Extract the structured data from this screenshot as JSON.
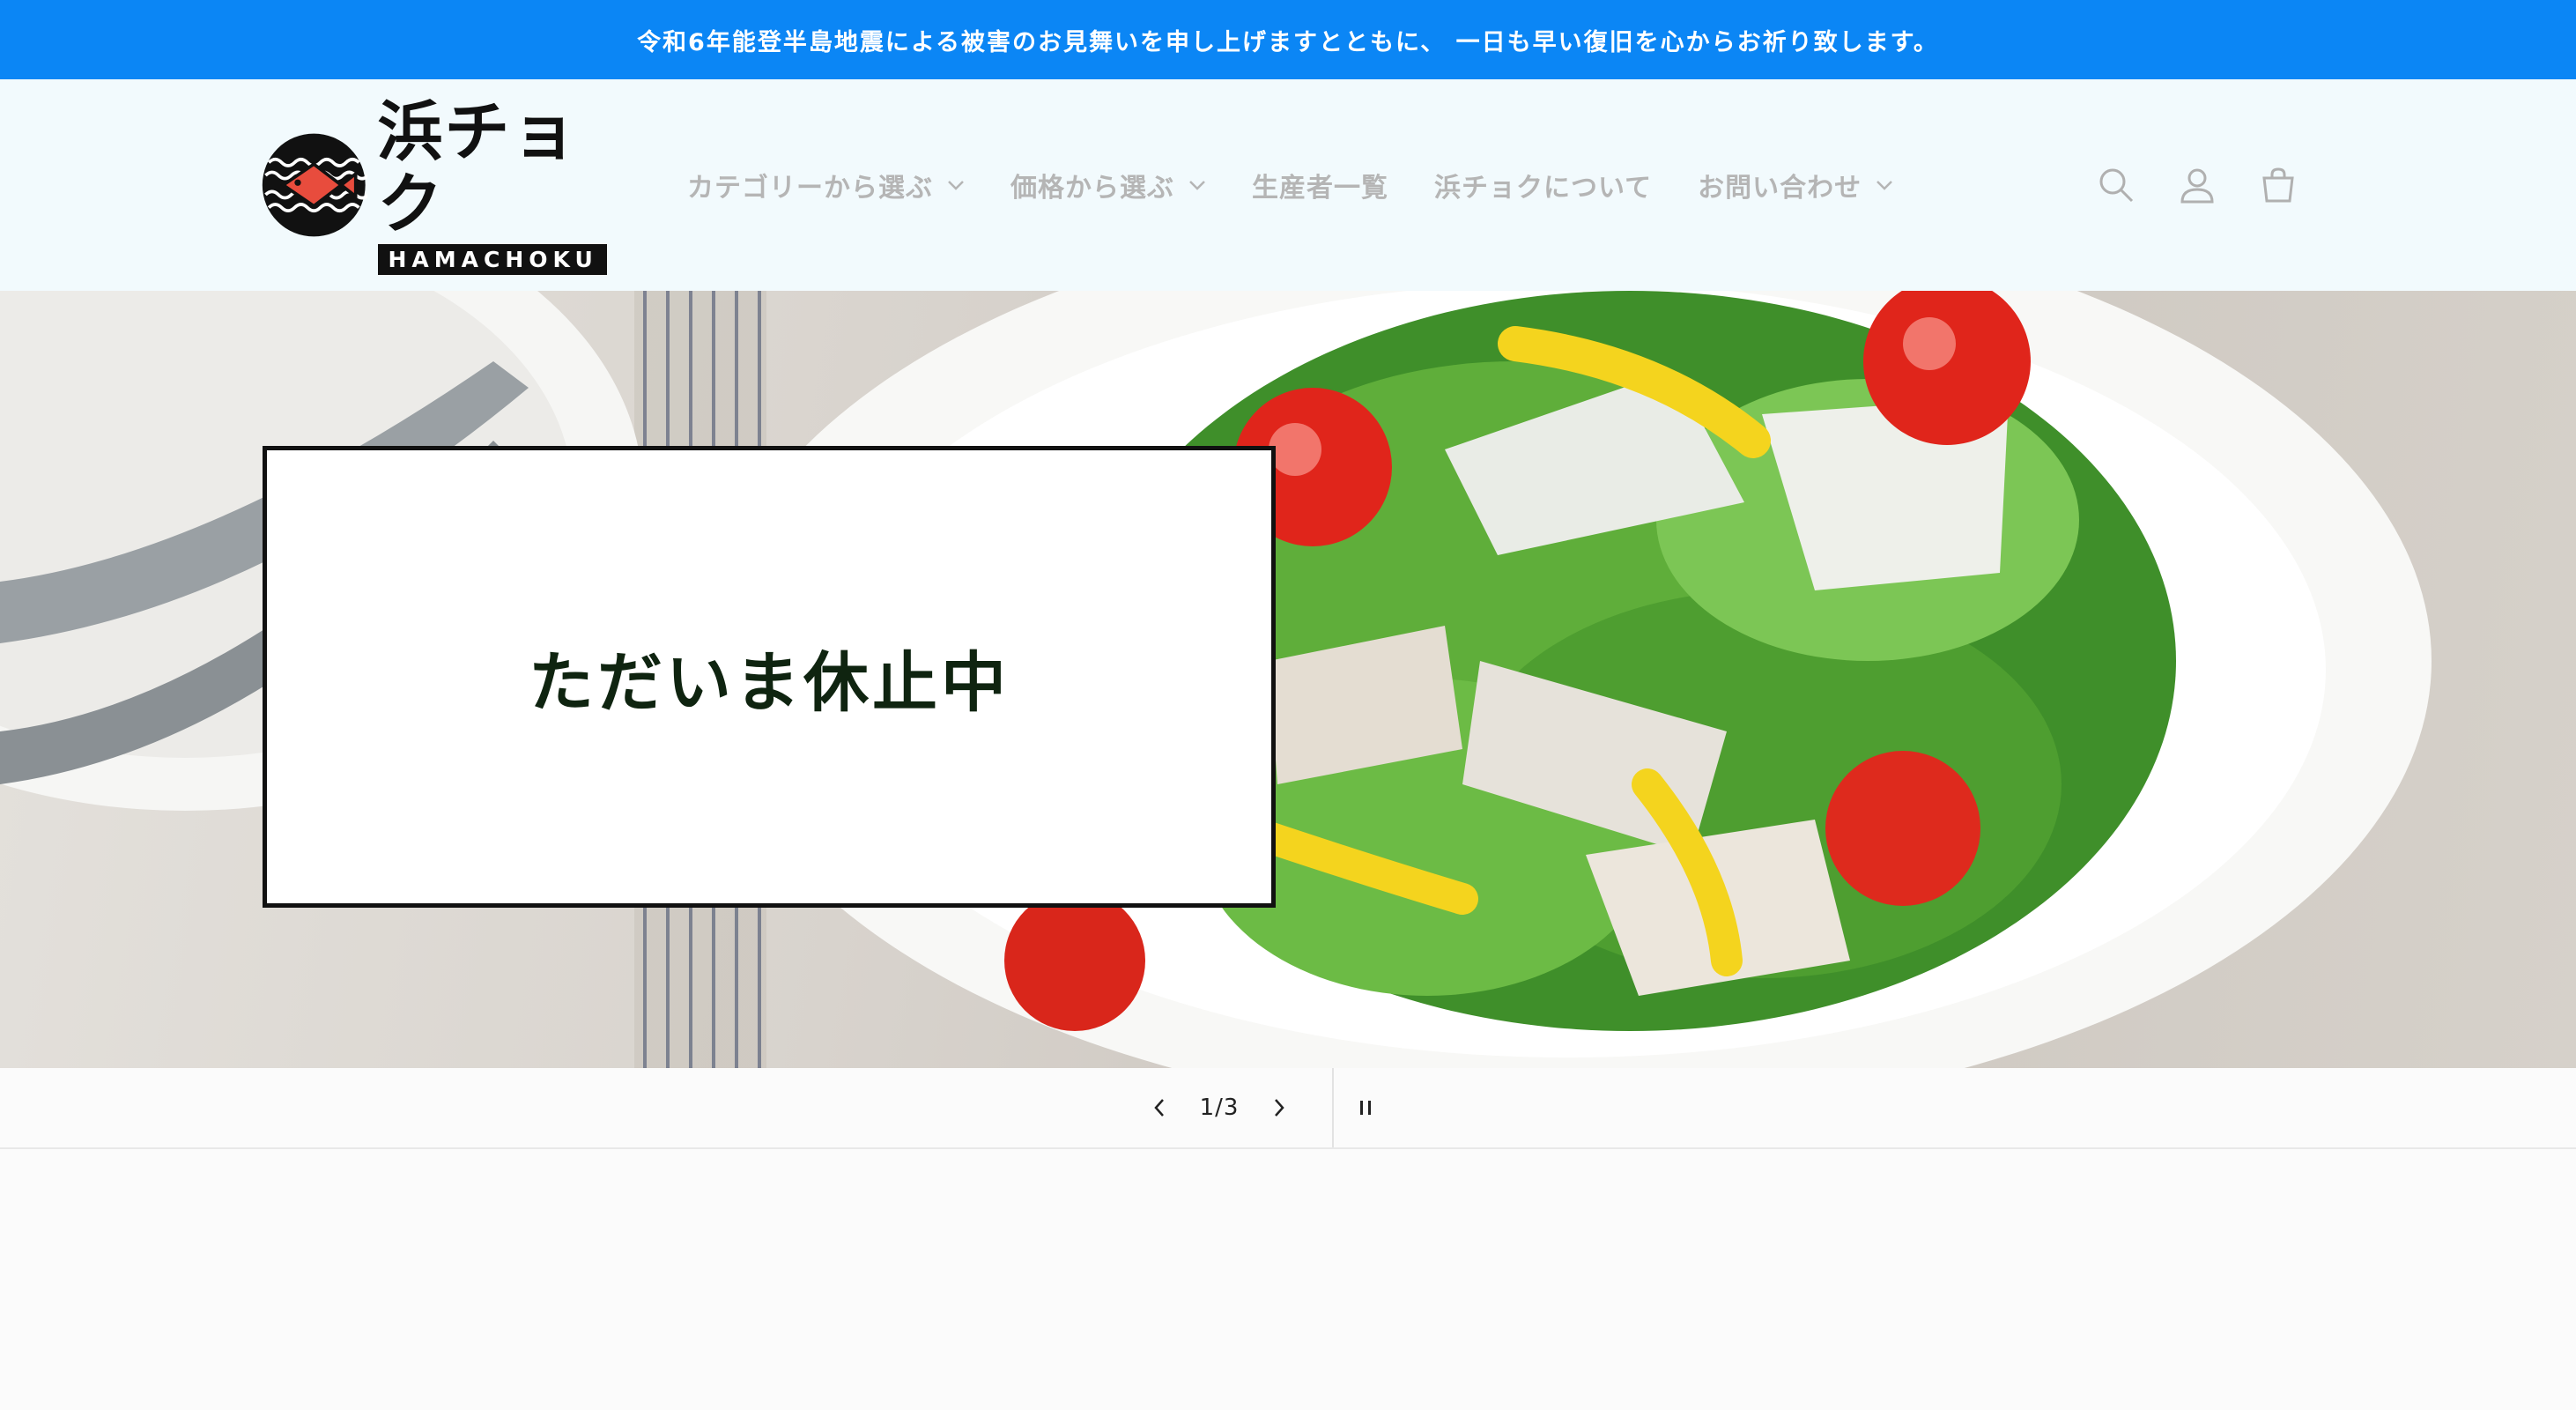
{
  "announcement": {
    "text": "令和6年能登半島地震による被害のお見舞いを申し上げますとともに、 一日も早い復旧を心からお祈り致します。"
  },
  "brand": {
    "name_jp": "浜チョク",
    "name_en": "HAMACHOKU",
    "accent_color": "#e84c3d"
  },
  "nav": {
    "items": [
      {
        "label": "カテゴリーから選ぶ",
        "has_dropdown": true
      },
      {
        "label": "価格から選ぶ",
        "has_dropdown": true
      },
      {
        "label": "生産者一覧",
        "has_dropdown": false
      },
      {
        "label": "浜チョクについて",
        "has_dropdown": false
      },
      {
        "label": "お問い合わせ",
        "has_dropdown": true
      }
    ]
  },
  "header_icons": [
    "search-icon",
    "account-icon",
    "cart-icon"
  ],
  "hero": {
    "heading": "ただいま休止中"
  },
  "slider": {
    "counter": "1/3"
  },
  "colors": {
    "announcement_bg": "#0b86f5",
    "header_bg": "#f2fafd",
    "heading_color": "#0f2410"
  }
}
